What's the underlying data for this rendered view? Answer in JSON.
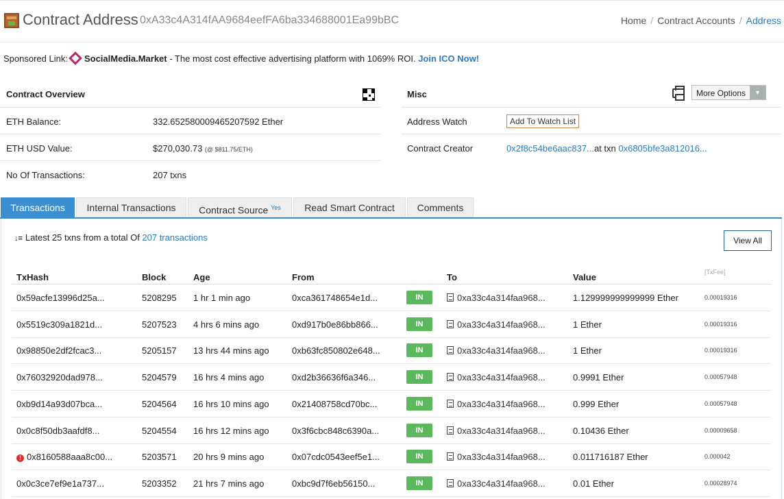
{
  "header": {
    "title": "Contract Address",
    "address": "0xA33c4A314fAA9684eefFA6ba334688001Ea99bBC",
    "breadcrumb": [
      "Home",
      "Contract Accounts",
      "Address"
    ]
  },
  "sponsored": {
    "label": "Sponsored Link:",
    "brand": "SocialMedia.Market",
    "text": " - The most cost effective advertising platform with 1069% ROI. ",
    "cta": "Join ICO Now!"
  },
  "overview": {
    "title": "Contract Overview",
    "rows": [
      {
        "label": "ETH Balance:",
        "value": "332.652580009465207592 Ether"
      },
      {
        "label": "ETH USD Value:",
        "value": "$270,030.73",
        "note": "(@ $811.75/ETH)"
      },
      {
        "label": "No Of Transactions:",
        "value": "207 txns"
      }
    ]
  },
  "misc": {
    "title": "Misc",
    "more_options": "More Options",
    "address_watch_label": "Address Watch",
    "watch_button": "Add To Watch List",
    "creator_label": "Contract Creator",
    "creator_address": "0x2f8c54be6aac837...",
    "creator_at": "at txn",
    "creator_txn": "0x6805bfe3a812016..."
  },
  "tabs": [
    {
      "label": "Transactions",
      "active": true
    },
    {
      "label": "Internal Transactions"
    },
    {
      "label": "Contract Source",
      "badge": "Yes"
    },
    {
      "label": "Read Smart Contract"
    },
    {
      "label": "Comments"
    }
  ],
  "summary": {
    "prefix": "Latest 25 txns from a total Of ",
    "link": "207 transactions",
    "view_all": "View All"
  },
  "table": {
    "headers": {
      "hash": "TxHash",
      "block": "Block",
      "age": "Age",
      "from": "From",
      "to": "To",
      "value": "Value",
      "fee": "[TxFee]"
    },
    "rows": [
      {
        "hash": "0x59acfe13996d25a...",
        "block": "5208295",
        "age": "1 hr 1 min ago",
        "from": "0xca361748654e1d...",
        "dir": "IN",
        "to": "0xa33c4a314faa968...",
        "value": "1.129999999999999 Ether",
        "fee": "0.00019316"
      },
      {
        "hash": "0x5519c309a1821d...",
        "block": "5207523",
        "age": "4 hrs 6 mins ago",
        "from": "0xd917b0e86bb866...",
        "dir": "IN",
        "to": "0xa33c4a314faa968...",
        "value": "1 Ether",
        "fee": "0.00019316"
      },
      {
        "hash": "0x98850e2df2fcac3...",
        "block": "5205157",
        "age": "13 hrs 44 mins ago",
        "from": "0xb63fc850802e648...",
        "dir": "IN",
        "to": "0xa33c4a314faa968...",
        "value": "1 Ether",
        "fee": "0.00019316"
      },
      {
        "hash": "0x76032920dad978...",
        "block": "5204579",
        "age": "16 hrs 4 mins ago",
        "from": "0xd2b36636f6a346...",
        "dir": "IN",
        "to": "0xa33c4a314faa968...",
        "value": "0.9991 Ether",
        "fee": "0.00057948"
      },
      {
        "hash": "0xb9d14a93d07bca...",
        "block": "5204564",
        "age": "16 hrs 10 mins ago",
        "from": "0x21408758cd70bc...",
        "dir": "IN",
        "to": "0xa33c4a314faa968...",
        "value": "0.999 Ether",
        "fee": "0.00057948"
      },
      {
        "hash": "0x0c8f50db3aafdf8...",
        "block": "5204554",
        "age": "16 hrs 12 mins ago",
        "from": "0x3f6cbc848c6390a...",
        "dir": "IN",
        "to": "0xa33c4a314faa968...",
        "value": "0.10436 Ether",
        "fee": "0.00009658"
      },
      {
        "hash": "0x8160588aaa8c00...",
        "error": true,
        "block": "5203571",
        "age": "20 hrs 9 mins ago",
        "from": "0x07cdc0543eef5e1...",
        "dir": "IN",
        "to": "0xa33c4a314faa968...",
        "value": "0.011716187 Ether",
        "fee": "0.000042"
      },
      {
        "hash": "0x0c3ce7ef9e1a737...",
        "block": "5203352",
        "age": "21 hrs 7 mins ago",
        "from": "0xbc9d7f6eb56150...",
        "dir": "IN",
        "to": "0xa33c4a314faa968...",
        "value": "0.01 Ether",
        "fee": "0.00028974"
      }
    ]
  },
  "colors": {
    "accent": "#3b8fd0",
    "link": "#2b7bc0",
    "in_badge": "#5cb85c",
    "watch_border": "#d0844a",
    "error": "#d9302a"
  },
  "icons": [
    "contract-icon",
    "qr-code-icon",
    "print-icon",
    "caret-down-icon",
    "sort-icon",
    "document-icon",
    "error-icon",
    "diamond-logo-icon"
  ]
}
